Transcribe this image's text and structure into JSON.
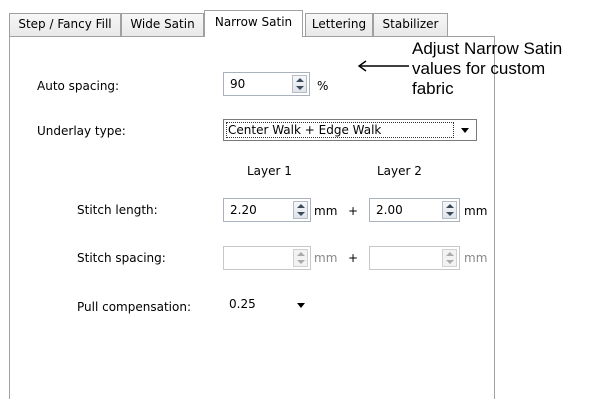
{
  "tabs": [
    {
      "label": "Step / Fancy Fill"
    },
    {
      "label": "Wide Satin"
    },
    {
      "label": "Narrow Satin"
    },
    {
      "label": "Lettering"
    },
    {
      "label": "Stabilizer"
    }
  ],
  "active_tab": "Narrow Satin",
  "auto_spacing": {
    "label": "Auto spacing:",
    "value": "90",
    "unit": "%"
  },
  "underlay_type": {
    "label": "Underlay type:",
    "value": "Center Walk + Edge Walk"
  },
  "layers": {
    "layer1": "Layer 1",
    "layer2": "Layer 2"
  },
  "stitch_length": {
    "label": "Stitch length:",
    "layer1_value": "2.20",
    "layer2_value": "2.00",
    "unit1": "mm",
    "unit2": "mm",
    "plus": "+"
  },
  "stitch_spacing": {
    "label": "Stitch spacing:",
    "layer1_value": "",
    "layer2_value": "",
    "unit1": "mm",
    "unit2": "mm",
    "plus": "+"
  },
  "pull_compensation": {
    "label": "Pull compensation:",
    "value": "0.25"
  },
  "annotation": {
    "line1": "Adjust Narrow Satin",
    "line2": "values for custom",
    "line3": "fabric"
  }
}
